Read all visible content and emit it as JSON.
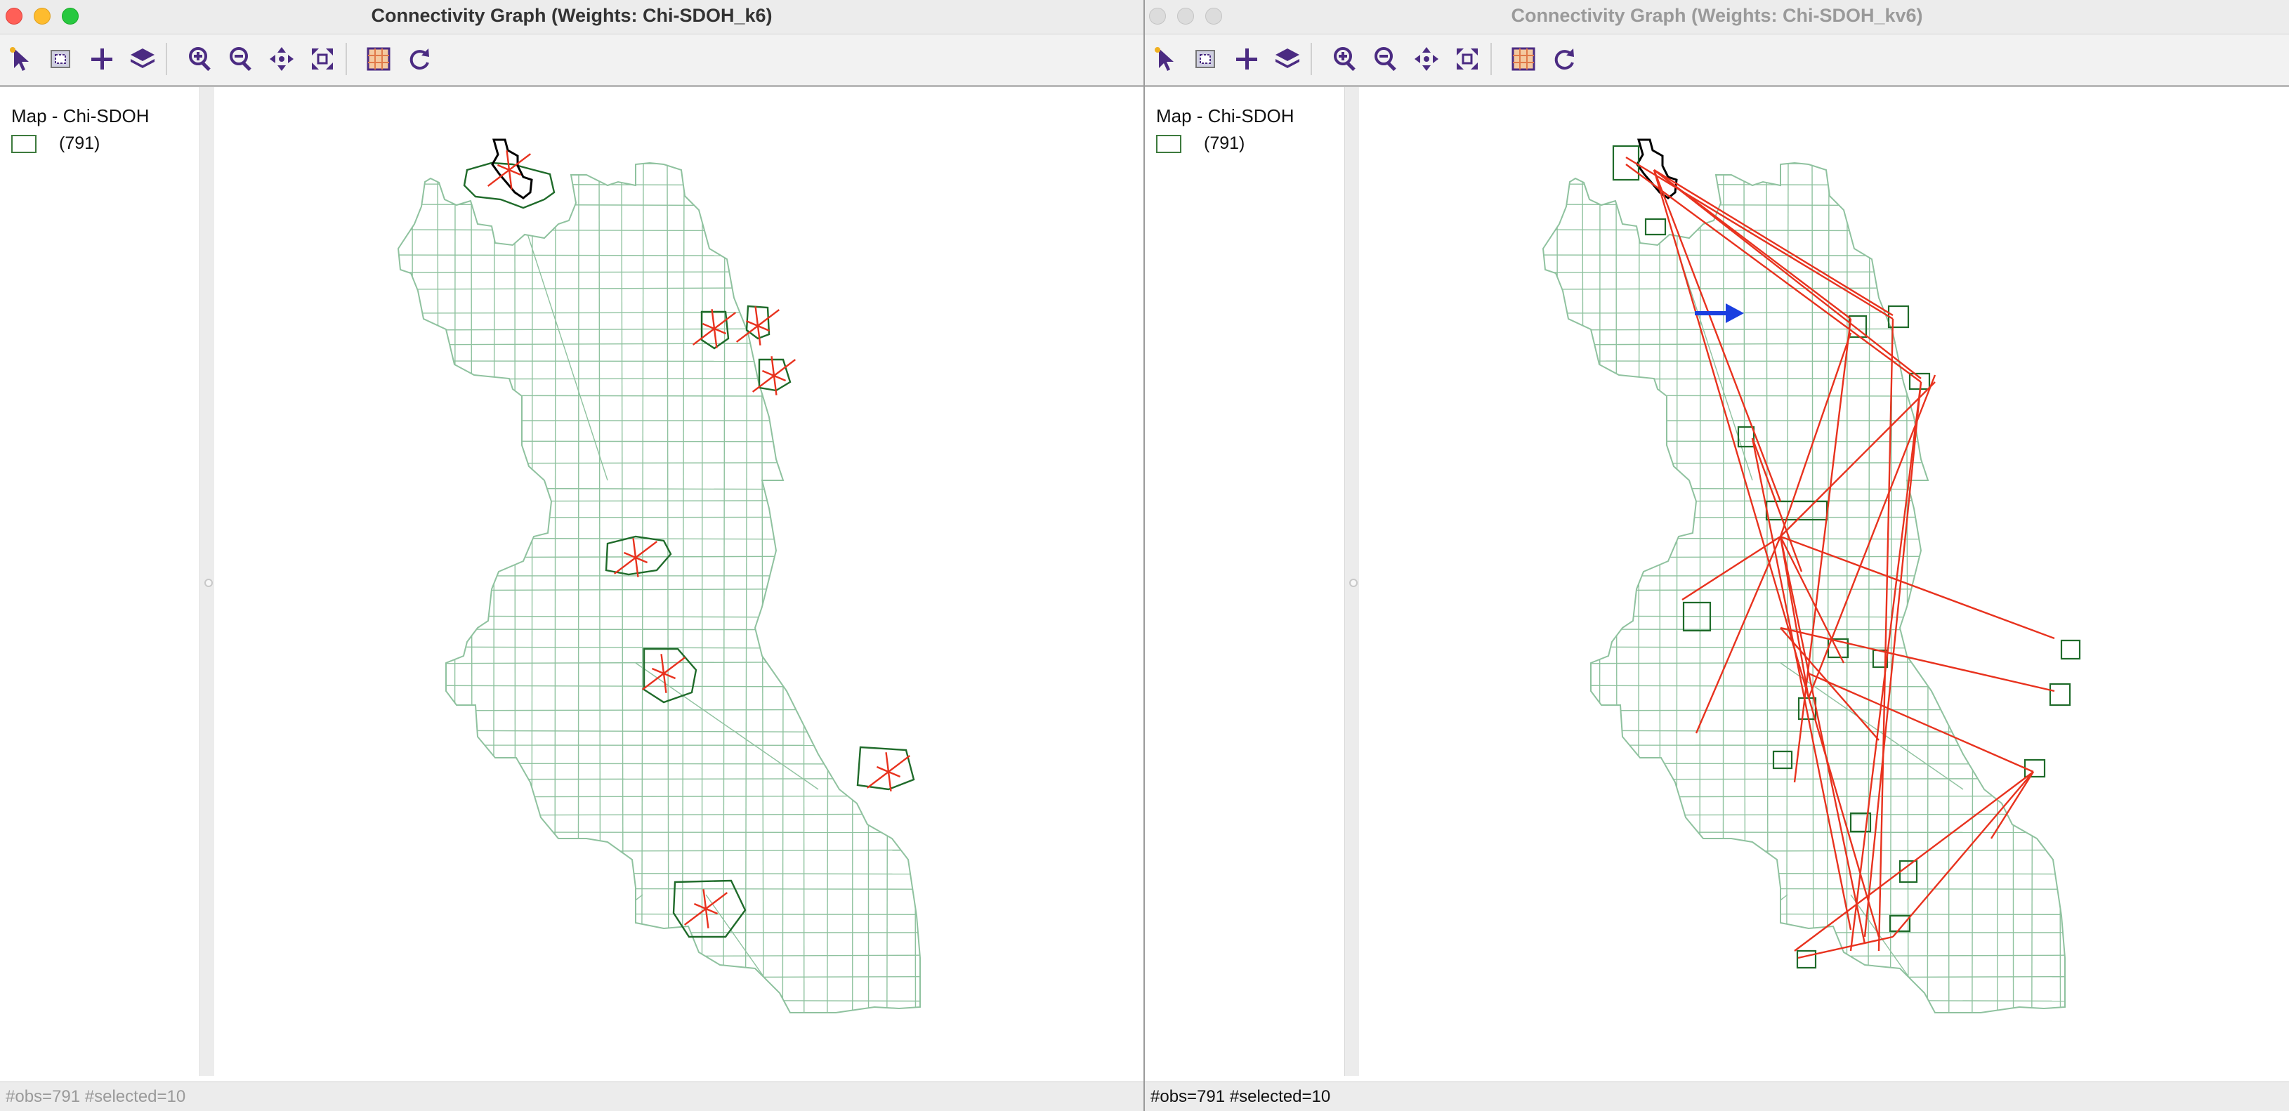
{
  "windows": [
    {
      "id": "left",
      "title": "Connectivity Graph (Weights: Chi-SDOH_k6)",
      "active": true,
      "legend": {
        "title": "Map - Chi-SDOH",
        "count": "(791)"
      },
      "status": "#obs=791 #selected=10",
      "graph": "knn"
    },
    {
      "id": "right",
      "title": "Connectivity Graph (Weights: Chi-SDOH_kv6)",
      "active": false,
      "legend": {
        "title": "Map - Chi-SDOH",
        "count": "(791)"
      },
      "status": "#obs=791 #selected=10",
      "graph": "kernel-variable"
    }
  ],
  "toolbar": [
    {
      "name": "select-tool-icon",
      "tooltip": ""
    },
    {
      "name": "selection-shape-icon",
      "tooltip": ""
    },
    {
      "name": "add-point-icon",
      "tooltip": ""
    },
    {
      "name": "layers-icon",
      "tooltip": ""
    },
    {
      "name": "zoom-in-icon",
      "tooltip": ""
    },
    {
      "name": "zoom-out-icon",
      "tooltip": ""
    },
    {
      "name": "pan-icon",
      "tooltip": ""
    },
    {
      "name": "fit-to-extent-icon",
      "tooltip": ""
    },
    {
      "name": "map-settings-icon",
      "tooltip": ""
    },
    {
      "name": "refresh-icon",
      "tooltip": ""
    }
  ],
  "colors": {
    "titlebar": "#ececec",
    "toolbar_icon": "#4b2b82",
    "map_outline": "#8fc29f",
    "selected_outline": "#1f6b2a",
    "edge": "#e8321e",
    "arrow": "#1a3fe0",
    "status_text_inactive": "#9a9a9a",
    "status_text_active": "#111111"
  },
  "map": {
    "region": "Chicago census tracts",
    "selected_count": 10,
    "annotation": "blue-arrow-icon"
  }
}
